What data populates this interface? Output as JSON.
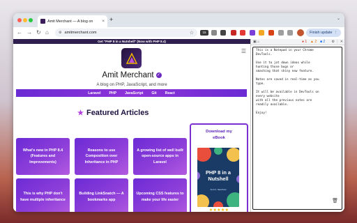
{
  "browser": {
    "tab_title": "Amit Merchant — A blog on",
    "new_tab": "+",
    "tab_close": "×",
    "url": "amitmerchant.com",
    "finish_update": "Finish update",
    "extension_badge": "15"
  },
  "page": {
    "banner": "Get \"PHP 8 in a Nutshell\" (Now with PHP 8.4)",
    "site_title": "Amit Merchant",
    "tagline": "A blog on PHP, JavaScript, and more",
    "menu": [
      "Laravel",
      "PHP",
      "JavaScript",
      "Git",
      "React"
    ],
    "featured_heading": "Featured Articles",
    "articles": [
      "What's new in PHP 8.4 (Features and Improvements)",
      "Reasons to use Composition over Inheritance in PHP",
      "A growing list of well built open-source apps in Laravel",
      "This is why PHP don't have multiple inheritance",
      "Building LinkSnatch — A bookmarks app",
      "Upcoming CSS features to make your life easier"
    ],
    "ebook": {
      "label_line1": "Download my",
      "label_line2": "eBook",
      "book_title": "PHP 8 in a Nutshell",
      "book_author": "Amit K. Merchant",
      "stars": "★★★★★"
    }
  },
  "devtools": {
    "error_count": "1",
    "warning_count": "2",
    "info_count": "2",
    "notes_lines": [
      "This is a Notepad in your Chrome",
      "DevTools.",
      "",
      "Use it to jot down ideas while",
      "hunting those bugs or",
      "smashing that shiny new feature.",
      "",
      "Notes are saved in real-time as you",
      "type.",
      "",
      "It will be available in DevTools on",
      "every website",
      "with all the previous notes are",
      "readily available.",
      "",
      "Enjoy!"
    ]
  },
  "colors": {
    "accent_purple": "#6c2bd5",
    "banner_bg": "#2e1f4e",
    "finish_button_bg": "#d4e0f5"
  }
}
